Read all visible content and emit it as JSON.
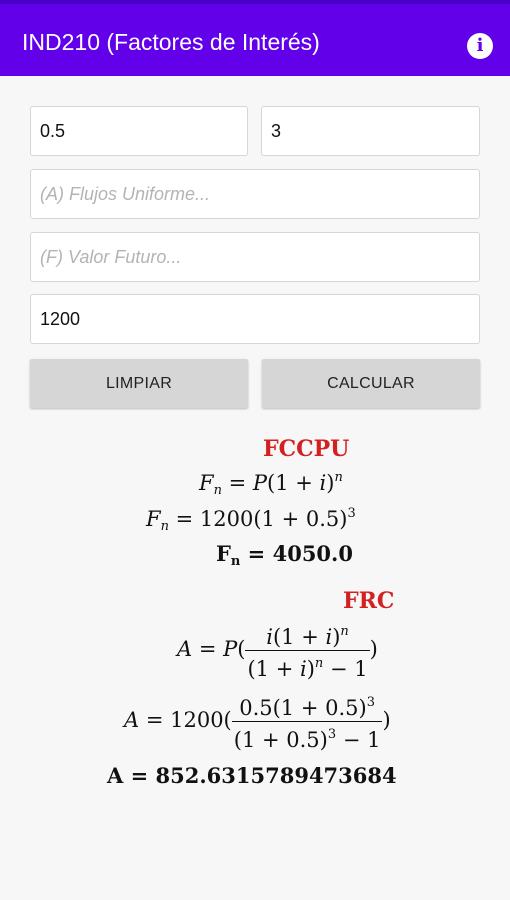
{
  "appbar": {
    "title": "IND210 (Factores de Interés)",
    "info_icon": "info-icon"
  },
  "inputs": {
    "rate_value": "0.5",
    "periods_value": "3",
    "uniform_placeholder": "(A) Flujos Uniforme...",
    "future_placeholder": "(F) Valor Futuro...",
    "present_value": "1200"
  },
  "buttons": {
    "clear_label": "LIMPIAR",
    "calculate_label": "CALCULAR"
  },
  "results": {
    "fccpu": {
      "heading": "FCCPU",
      "formula": {
        "lhs": "F",
        "lhs_sub": "n",
        "eq": " = ",
        "p": "P",
        "open": "(1 + ",
        "i": "i",
        "close": ")",
        "exp": "n"
      },
      "substituted": {
        "lhs": "F",
        "lhs_sub": "n",
        "text": " = 1200(1 + 0.5)",
        "exp": "3"
      },
      "result": {
        "lhs": "F",
        "lhs_sub": "n",
        "text": " = 4050.0"
      }
    },
    "frc": {
      "heading": "FRC",
      "formula": {
        "lhs": "A",
        "eq": " = ",
        "p": "P",
        "open": "(",
        "close": ")",
        "num_i": "i",
        "num_mid": "(1 + ",
        "num_i2": "i",
        "num_close": ")",
        "num_exp": "n",
        "den_open": "(1 + ",
        "den_i": "i",
        "den_close": ")",
        "den_exp": "n",
        "den_tail": " − 1"
      },
      "substituted": {
        "lhs": "A",
        "text": " = 1200(",
        "close": ")",
        "num": "0.5(1 + 0.5)",
        "num_exp": "3",
        "den": "(1 + 0.5)",
        "den_exp": "3",
        "den_tail": " − 1"
      },
      "result": {
        "text": "A = 852.6315789473684"
      }
    }
  }
}
